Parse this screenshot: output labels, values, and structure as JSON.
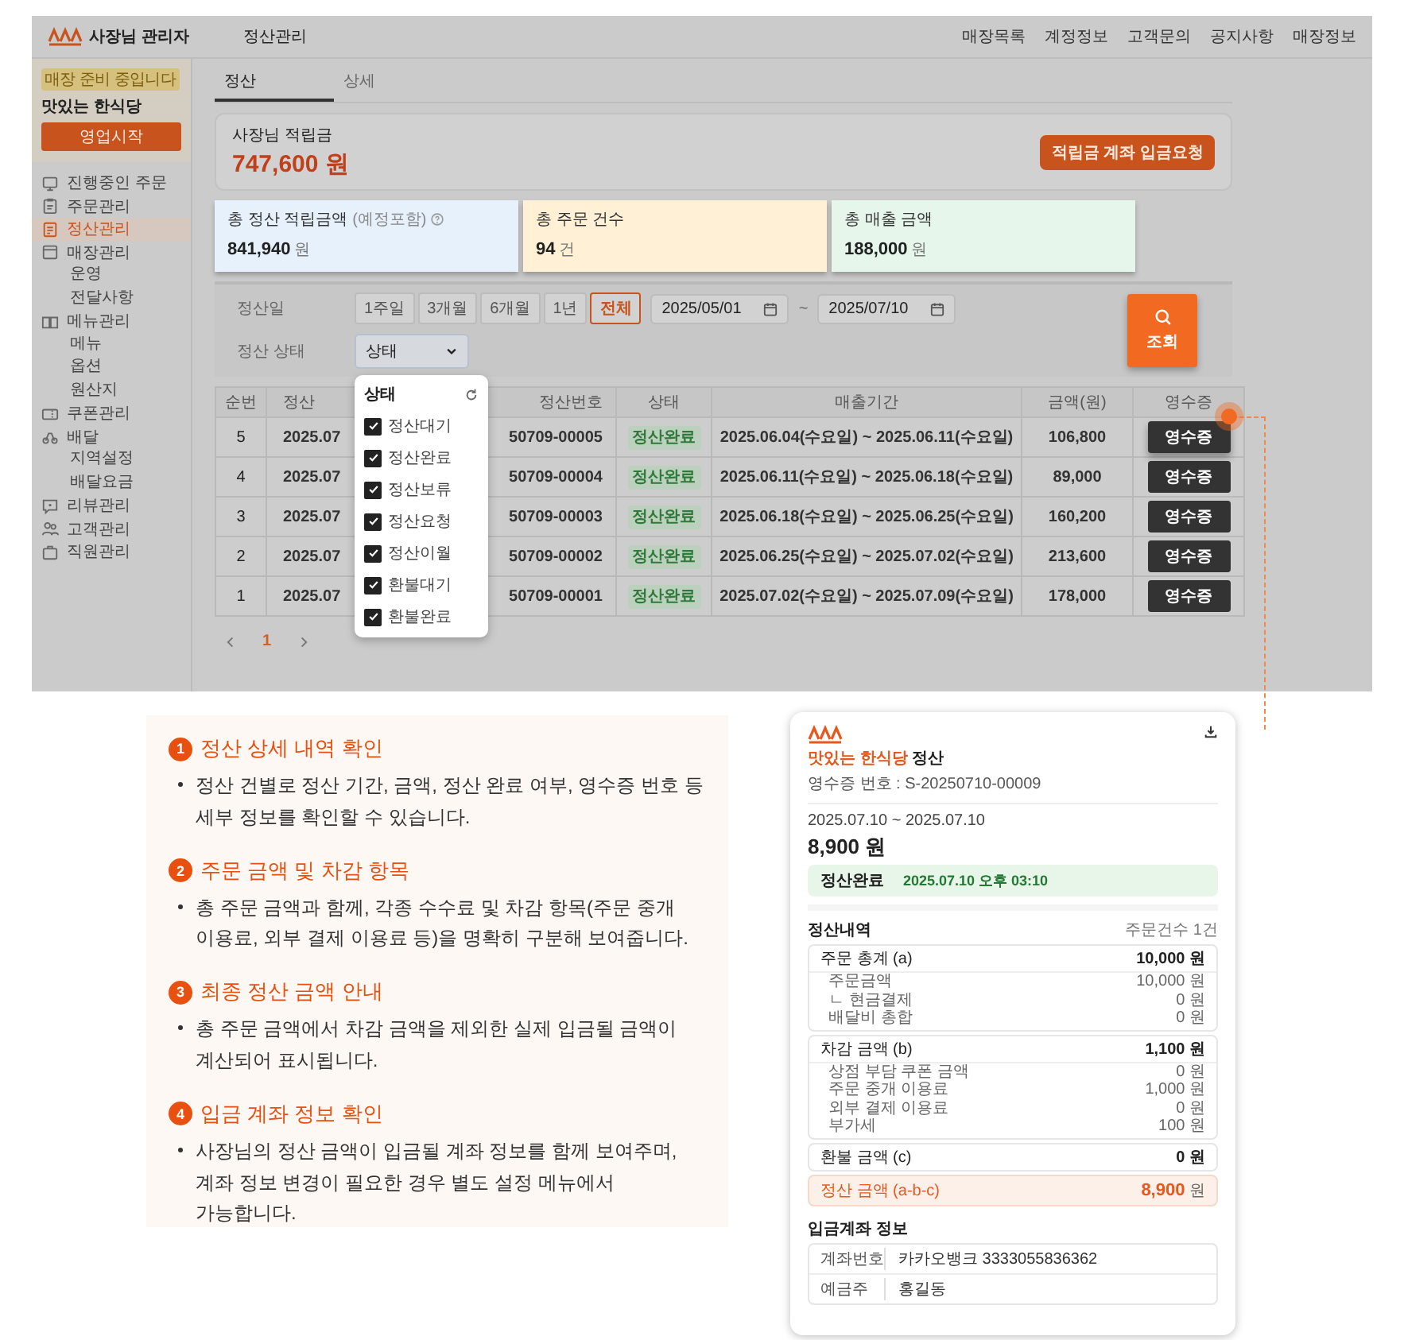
{
  "header": {
    "brand": "사장님 관리자",
    "page_title": "정산관리",
    "nav": [
      "매장목록",
      "계정정보",
      "고객문의",
      "공지사항",
      "매장정보"
    ]
  },
  "sidebar": {
    "notice": "매장 준비 중입니다",
    "store_name": "맛있는 한식당",
    "open_button": "영업시작",
    "items": [
      {
        "label": "진행중인 주문",
        "selected": false
      },
      {
        "label": "주문관리",
        "selected": false
      },
      {
        "label": "정산관리",
        "selected": true
      },
      {
        "label": "매장관리",
        "selected": false,
        "children": [
          {
            "label": "운영",
            "selected": false
          },
          {
            "label": "전달사항",
            "selected": false
          }
        ]
      },
      {
        "label": "메뉴관리",
        "selected": false,
        "children": [
          {
            "label": "메뉴",
            "selected": false
          },
          {
            "label": "옵션",
            "selected": false
          },
          {
            "label": "원산지",
            "selected": false
          }
        ]
      },
      {
        "label": "쿠폰관리",
        "selected": false
      },
      {
        "label": "배달",
        "selected": false,
        "children": [
          {
            "label": "지역설정",
            "selected": false
          },
          {
            "label": "배달요금",
            "selected": false
          }
        ]
      },
      {
        "label": "리뷰관리",
        "selected": false
      },
      {
        "label": "고객관리",
        "selected": false
      },
      {
        "label": "직원관리",
        "selected": false
      }
    ]
  },
  "tabs": [
    {
      "label": "정산",
      "selected": true
    },
    {
      "label": "상세",
      "selected": false
    }
  ],
  "balance": {
    "label": "사장님 적립금",
    "amount": "747,600 원",
    "button": "적립금 계좌 입금요청"
  },
  "stats": [
    {
      "label": "총 정산 적립금액",
      "note": "(예정포함)",
      "help": true,
      "value": "841,940",
      "unit": "원",
      "color": "#e6f1fc"
    },
    {
      "label": "총 주문 건수",
      "help": false,
      "value": "94",
      "unit": "건",
      "color": "#fff0d6"
    },
    {
      "label": "총 매출 금액",
      "help": false,
      "value": "188,000",
      "unit": "원",
      "color": "#e7f6ea"
    }
  ],
  "filter": {
    "date_label": "정산일",
    "periods": [
      {
        "label": "1주일",
        "selected": false
      },
      {
        "label": "3개월",
        "selected": false
      },
      {
        "label": "6개월",
        "selected": false
      },
      {
        "label": "1년",
        "selected": false
      },
      {
        "label": "전체",
        "selected": true
      }
    ],
    "start_date": "2025/05/01",
    "separator": "~",
    "end_date": "2025/07/10",
    "status_label": "정산 상태",
    "status_select": "상태",
    "search_button": "조회"
  },
  "dropdown": {
    "title": "상태",
    "options": [
      {
        "label": "정산대기",
        "checked": true
      },
      {
        "label": "정산완료",
        "checked": true
      },
      {
        "label": "정산보류",
        "checked": true
      },
      {
        "label": "정산요청",
        "checked": true
      },
      {
        "label": "정산이월",
        "checked": true
      },
      {
        "label": "환불대기",
        "checked": true
      },
      {
        "label": "환불완료",
        "checked": true
      }
    ]
  },
  "table": {
    "columns": [
      "순번",
      "정산",
      "정산번호",
      "상태",
      "매출기간",
      "금액(원)",
      "영수증"
    ],
    "rows": [
      {
        "no": "5",
        "date": "2025.07",
        "number": "50709-00005",
        "status": "정산완료",
        "period": "2025.06.04(수요일) ~ 2025.06.11(수요일)",
        "amount": "106,800",
        "receipt": "영수증",
        "highlighted": true
      },
      {
        "no": "4",
        "date": "2025.07",
        "number": "50709-00004",
        "status": "정산완료",
        "period": "2025.06.11(수요일) ~ 2025.06.18(수요일)",
        "amount": "89,000",
        "receipt": "영수증",
        "highlighted": false
      },
      {
        "no": "3",
        "date": "2025.07",
        "number": "50709-00003",
        "status": "정산완료",
        "period": "2025.06.18(수요일) ~ 2025.06.25(수요일)",
        "amount": "160,200",
        "receipt": "영수증",
        "highlighted": false
      },
      {
        "no": "2",
        "date": "2025.07",
        "number": "50709-00002",
        "status": "정산완료",
        "period": "2025.06.25(수요일) ~ 2025.07.02(수요일)",
        "amount": "213,600",
        "receipt": "영수증",
        "highlighted": false
      },
      {
        "no": "1",
        "date": "2025.07",
        "number": "50709-00001",
        "status": "정산완료",
        "period": "2025.07.02(수요일) ~ 2025.07.09(수요일)",
        "amount": "178,000",
        "receipt": "영수증",
        "highlighted": false
      }
    ]
  },
  "pagination": {
    "pages": [
      {
        "label": "1",
        "selected": true
      }
    ]
  },
  "guide": [
    {
      "number": "1",
      "title": "정산 상세 내역 확인",
      "text": "정산 건별로 정산 기간, 금액, 정산 완료 여부, 영수증 번호 등 세부 정보를 확인할 수 있습니다."
    },
    {
      "number": "2",
      "title": "주문 금액 및 차감 항목",
      "text": "총 주문 금액과 함께, 각종 수수료 및 차감 항목(주문 중개 이용료, 외부 결제 이용료 등)을 명확히 구분해 보여줍니다."
    },
    {
      "number": "3",
      "title": "최종 정산 금액 안내",
      "text": "총 주문 금액에서 차감 금액을 제외한 실제 입금될 금액이 계산되어 표시됩니다."
    },
    {
      "number": "4",
      "title": "입금 계좌 정보 확인",
      "text": "사장님의 정산 금액이 입금될 계좌 정보를 함께 보여주며, 계좌 정보 변경이 필요한 경우 별도 설정 메뉴에서 가능합니다."
    }
  ],
  "receipt": {
    "store": "맛있는 한식당",
    "store_suffix": "정산",
    "receipt_no": "영수증 번호 : S-20250710-00009",
    "period": "2025.07.10 ~ 2025.07.10",
    "amount": "8,900 원",
    "status": "정산완료",
    "status_time": "2025.07.10 오후 03:10",
    "details_title": "정산내역",
    "order_count": "주문건수 1건",
    "groups": [
      {
        "label": "주문 총계 (a)",
        "value": "10,000 원",
        "items": [
          {
            "label": "주문금액",
            "value": "10,000 원"
          },
          {
            "label": "ㄴ 현금결제",
            "value": "0 원"
          },
          {
            "label": "배달비 총합",
            "value": "0 원"
          }
        ]
      },
      {
        "label": "차감 금액 (b)",
        "value": "1,100 원",
        "items": [
          {
            "label": "상점 부담 쿠폰 금액",
            "value": "0 원"
          },
          {
            "label": "주문 중개 이용료",
            "value": "1,000 원"
          },
          {
            "label": "외부 결제 이용료",
            "value": "0 원"
          },
          {
            "label": "부가세",
            "value": "100 원"
          }
        ]
      },
      {
        "label": "환불 금액 (c)",
        "value": "0 원"
      }
    ],
    "total": {
      "label": "정산 금액 (a-b-c)",
      "value": "8,900",
      "unit": "원"
    },
    "account_title": "입금계좌 정보",
    "account": [
      {
        "label": "계좌번호",
        "value": "카카오뱅크  3333055836362"
      },
      {
        "label": "예금주",
        "value": "홍길동"
      }
    ]
  }
}
